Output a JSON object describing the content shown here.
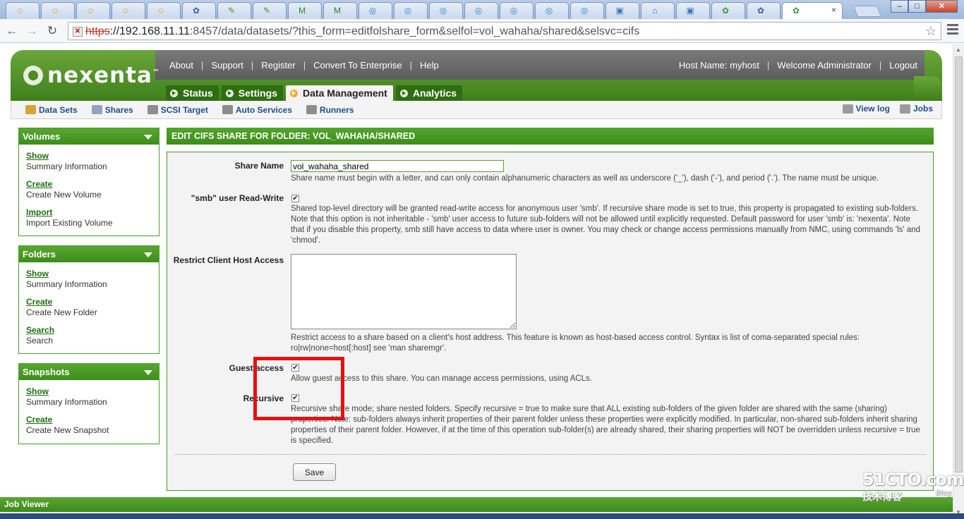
{
  "browser": {
    "tab_count": 23,
    "active_tab_close": "×",
    "address_bar": {
      "scheme": "https",
      "host": "://192.168.11.11",
      "rest": ":8457/data/datasets/?this_form=editfolshare_form&selfol=vol_wahaha/shared&selsvc=cifs"
    },
    "window_controls": {
      "minimize": "–",
      "maximize": "□",
      "close": "✕"
    }
  },
  "header": {
    "logo_text": "nexenta",
    "logo_tm": "™",
    "links": [
      "About",
      "Support",
      "Register",
      "Convert To Enterprise",
      "Help"
    ],
    "host_label": "Host Name: myhost",
    "welcome": "Welcome Administrator",
    "logout": "Logout",
    "tabs": [
      {
        "label": "Status",
        "active": false
      },
      {
        "label": "Settings",
        "active": false
      },
      {
        "label": "Data Management",
        "active": true
      },
      {
        "label": "Analytics",
        "active": false
      }
    ]
  },
  "subbar": {
    "left": [
      {
        "label": "Data Sets",
        "icon": "datasets-icon",
        "color": "#d4a43a"
      },
      {
        "label": "Shares",
        "icon": "shares-icon",
        "color": "#8fa3c4"
      },
      {
        "label": "SCSI Target",
        "icon": "scsi-tools-icon",
        "color": "#8d8d8d"
      },
      {
        "label": "Auto Services",
        "icon": "auto-services-gear-icon",
        "color": "#8d8d8d"
      },
      {
        "label": "Runners",
        "icon": "runners-icon",
        "color": "#8d8d8d"
      }
    ],
    "right": [
      {
        "label": "View log",
        "icon": "view-log-icon",
        "color": "#9a9a9a"
      },
      {
        "label": "Jobs",
        "icon": "jobs-gear-icon",
        "color": "#9a9a9a"
      }
    ]
  },
  "sidebar": {
    "panels": [
      {
        "title": "Volumes",
        "items": [
          {
            "link": "Show",
            "desc": "Summary Information"
          },
          {
            "link": "Create",
            "desc": "Create New Volume"
          },
          {
            "link": "Import",
            "desc": "Import Existing Volume"
          }
        ]
      },
      {
        "title": "Folders",
        "items": [
          {
            "link": "Show",
            "desc": "Summary Information"
          },
          {
            "link": "Create",
            "desc": "Create New Folder"
          },
          {
            "link": "Search",
            "desc": "Search"
          }
        ]
      },
      {
        "title": "Snapshots",
        "items": [
          {
            "link": "Show",
            "desc": "Summary Information"
          },
          {
            "link": "Create",
            "desc": "Create New Snapshot"
          }
        ]
      }
    ]
  },
  "form": {
    "title": "EDIT CIFS SHARE FOR FOLDER: VOL_WAHAHA/SHARED",
    "share_name": {
      "label": "Share Name",
      "value": "vol_wahaha_shared",
      "help": "Share name must begin with a letter, and can only contain alphanumeric characters as well as underscore ('_'), dash ('-'), and period ('.'). The name must be unique."
    },
    "smb_rw": {
      "label": "\"smb\" user Read-Write",
      "checked": true,
      "help": "Shared top-level directory will be granted read-write access for anonymous user 'smb'. If recursive share mode is set to true, this property is propagated to existing sub-folders. Note that this option is not inheritable - 'smb' user access to future sub-folders will not be allowed until explicitly requested. Default password for user 'smb' is: 'nexenta'. Note that if you disable this property, smb still have access to data where user is owner. You may check or change access permissions manually from NMC, using commands 'ls' and 'chmod'."
    },
    "restrict_hosts": {
      "label": "Restrict Client Host Access",
      "value": "",
      "help": "Restrict access to a share based on a client's host address. This feature is known as host-based access control. Syntax is list of coma-separated special rules: ro|rw|none=host[:host] see 'man sharemgr'."
    },
    "guest_access": {
      "label": "Guest access",
      "checked": true,
      "help": "Allow guest access to this share. You can manage access permissions, using ACLs."
    },
    "recursive": {
      "label": "Recursive",
      "checked": true,
      "help": "Recursive share mode; share nested folders. Specify recursive = true to make sure that ALL existing sub-folders of the given folder are shared with the same (sharing) properties. Note: sub-folders always inherit properties of their parent folder unless these properties were explicitly modified. In particular, non-shared sub-folders inherit sharing properties of their parent folder. However, if at the time of this operation sub-folder(s) are already shared, their sharing properties will NOT be overridden unless recursive = true is specified."
    },
    "save_label": "Save"
  },
  "job_viewer": "Job Viewer",
  "watermark": {
    "top": "51CTO.com",
    "bottom": "技术博客",
    "blog": "Blog"
  },
  "colors": {
    "brand_green": "#3f8d1c",
    "header_grey": "#666666",
    "highlight_red": "#e21212",
    "link_blue": "#1f4d8a"
  }
}
